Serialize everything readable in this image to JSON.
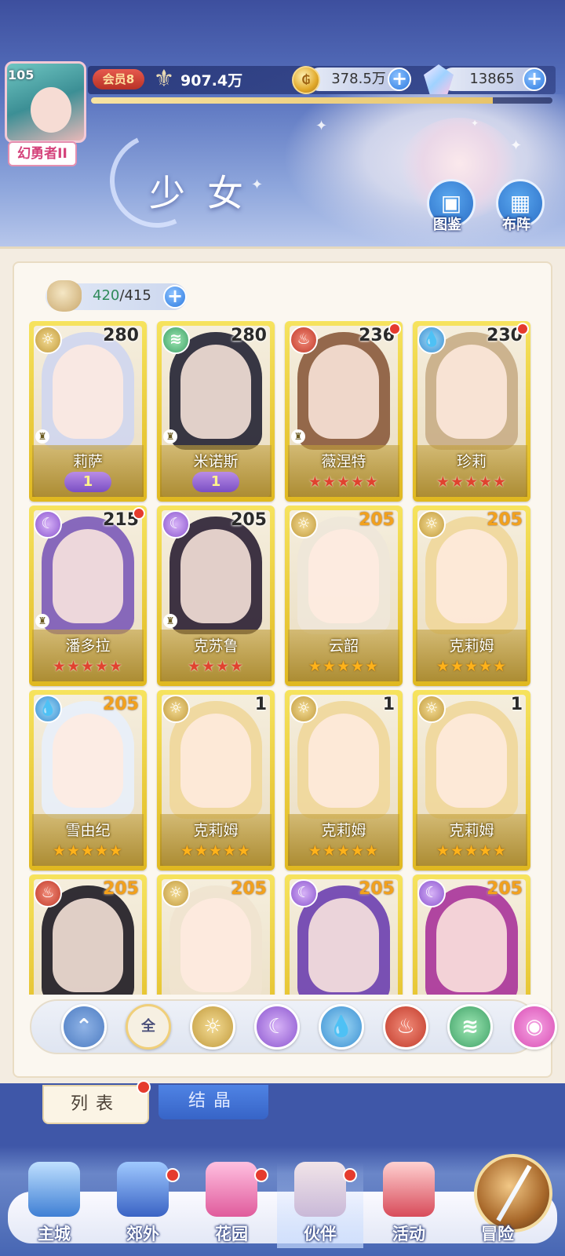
{
  "player": {
    "level": "105",
    "title": "幻勇者II",
    "vip": "会员8",
    "power": "907.4万"
  },
  "resources": {
    "gold": "378.5万",
    "gems": "13865",
    "exp_fill": 0.87
  },
  "page": {
    "section_title": "少女",
    "codex_label": "图鉴",
    "formation_label": "布阵"
  },
  "capacity": {
    "current": "420",
    "separator": "/",
    "max": "415"
  },
  "cards": [
    {
      "name": "莉萨",
      "level": "280",
      "element": "light",
      "stars": 0,
      "star_color": "red",
      "badge": "1",
      "dot": false,
      "rook": true
    },
    {
      "name": "米诺斯",
      "level": "280",
      "element": "wind",
      "stars": 0,
      "star_color": "red",
      "badge": "1",
      "dot": false,
      "rook": true
    },
    {
      "name": "薇涅特",
      "level": "236",
      "element": "fire",
      "stars": 5,
      "star_color": "red",
      "badge": "",
      "dot": true,
      "rook": true
    },
    {
      "name": "珍莉",
      "level": "230",
      "element": "water",
      "stars": 5,
      "star_color": "red",
      "badge": "",
      "dot": true,
      "rook": false
    },
    {
      "name": "潘多拉",
      "level": "215",
      "element": "dark",
      "stars": 5,
      "star_color": "red",
      "badge": "",
      "dot": true,
      "rook": true
    },
    {
      "name": "克苏鲁",
      "level": "205",
      "element": "dark",
      "stars": 4,
      "star_color": "red",
      "badge": "",
      "dot": false,
      "rook": true
    },
    {
      "name": "云韶",
      "level": "205",
      "element": "light",
      "stars": 5,
      "star_color": "gold",
      "badge": "",
      "dot": false,
      "rook": false
    },
    {
      "name": "克莉姆",
      "level": "205",
      "element": "light",
      "stars": 5,
      "star_color": "gold",
      "badge": "",
      "dot": false,
      "rook": false
    },
    {
      "name": "雪由纪",
      "level": "205",
      "element": "water",
      "stars": 5,
      "star_color": "gold",
      "badge": "",
      "dot": false,
      "rook": false
    },
    {
      "name": "克莉姆",
      "level": "1",
      "element": "light",
      "stars": 5,
      "star_color": "gold",
      "badge": "",
      "dot": false,
      "rook": false
    },
    {
      "name": "克莉姆",
      "level": "1",
      "element": "light",
      "stars": 5,
      "star_color": "gold",
      "badge": "",
      "dot": false,
      "rook": false
    },
    {
      "name": "克莉姆",
      "level": "1",
      "element": "light",
      "stars": 5,
      "star_color": "gold",
      "badge": "",
      "dot": false,
      "rook": false
    },
    {
      "name": "",
      "level": "205",
      "element": "fire",
      "stars": 0,
      "star_color": "gold",
      "badge": "",
      "dot": false,
      "rook": false
    },
    {
      "name": "",
      "level": "205",
      "element": "light",
      "stars": 0,
      "star_color": "gold",
      "badge": "",
      "dot": false,
      "rook": false
    },
    {
      "name": "",
      "level": "205",
      "element": "dark",
      "stars": 0,
      "star_color": "gold",
      "badge": "",
      "dot": false,
      "rook": false
    },
    {
      "name": "",
      "level": "205",
      "element": "dark",
      "stars": 0,
      "star_color": "gold",
      "badge": "",
      "dot": false,
      "rook": false
    }
  ],
  "filters": [
    {
      "id": "back",
      "label": "",
      "icon": "chevron-up-icon"
    },
    {
      "id": "all",
      "label": "全",
      "icon": "all-icon"
    },
    {
      "id": "light",
      "label": "",
      "icon": "sun-icon"
    },
    {
      "id": "dark",
      "label": "",
      "icon": "moon-icon"
    },
    {
      "id": "water",
      "label": "",
      "icon": "water-drop-icon"
    },
    {
      "id": "fire",
      "label": "",
      "icon": "fire-jar-icon"
    },
    {
      "id": "wind",
      "label": "",
      "icon": "wind-icon"
    },
    {
      "id": "pink",
      "label": "",
      "icon": "orb-icon"
    }
  ],
  "tabs": {
    "list": "列表",
    "crystal": "结晶"
  },
  "nav": [
    {
      "label": "主城",
      "dot": false
    },
    {
      "label": "郊外",
      "dot": true
    },
    {
      "label": "花园",
      "dot": true
    },
    {
      "label": "伙伴",
      "dot": true
    },
    {
      "label": "活动",
      "dot": false
    },
    {
      "label": "冒险",
      "dot": false
    }
  ],
  "colors": {
    "header_top": "#3d4f9e",
    "card_gold": "#e0b820",
    "notify_red": "#e53b2e",
    "nav_blue": "#4766b3"
  }
}
